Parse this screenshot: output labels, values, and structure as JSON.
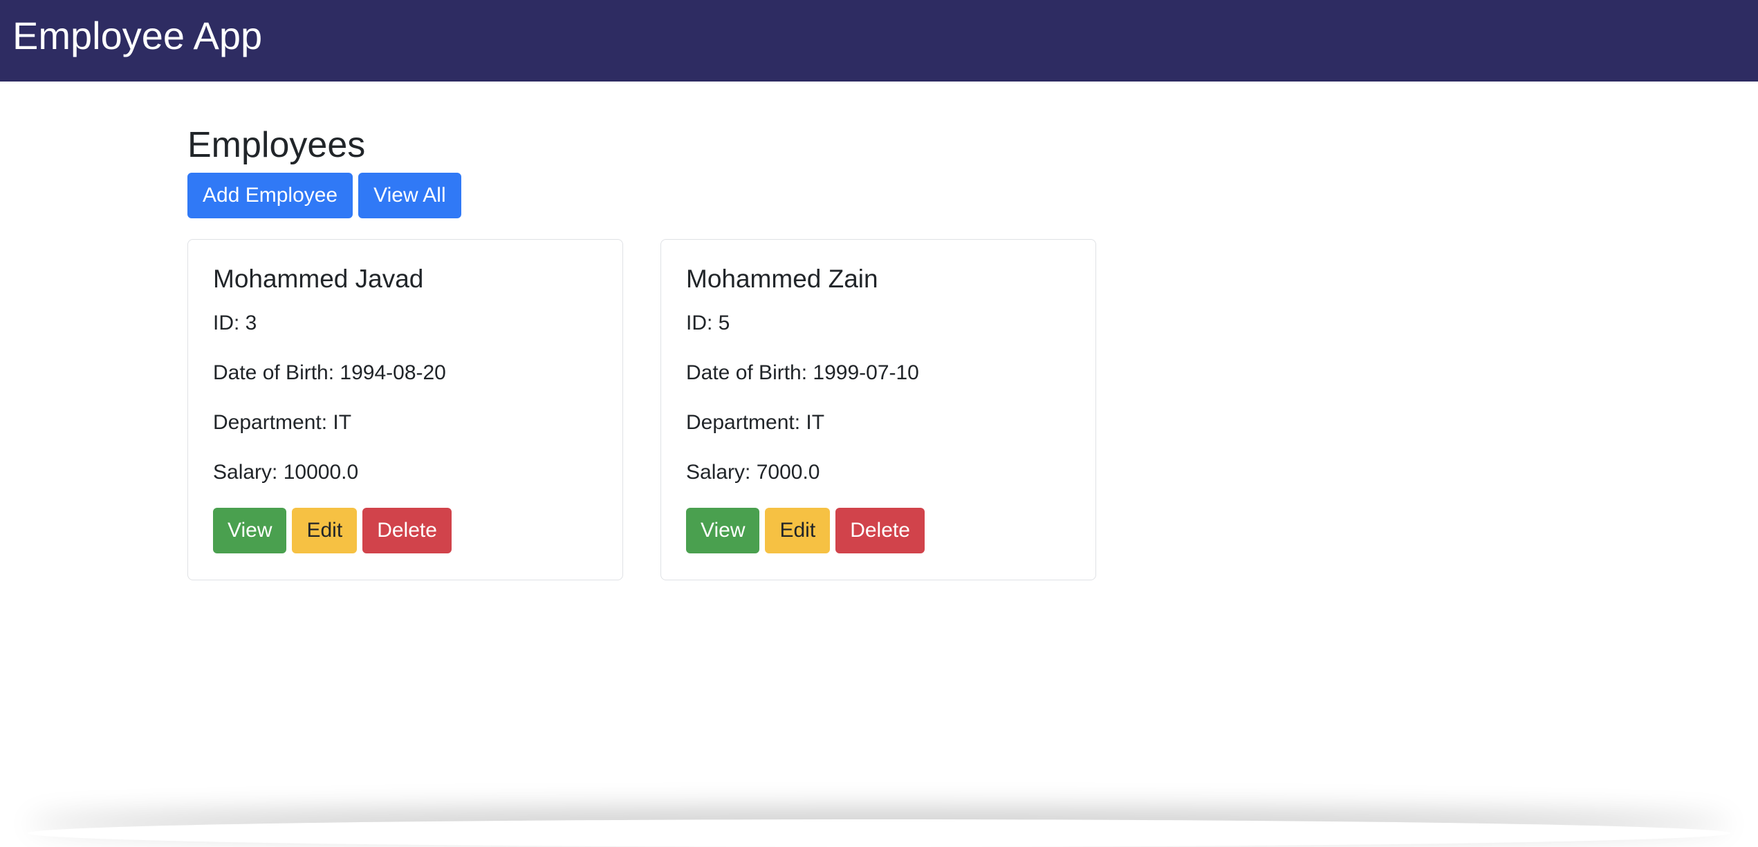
{
  "navbar": {
    "brand": "Employee App"
  },
  "page": {
    "title": "Employees",
    "actions": {
      "add_label": "Add Employee",
      "view_all_label": "View All"
    }
  },
  "employees": [
    {
      "name": "Mohammed Javad",
      "id_text": "ID: 3",
      "dob_text": "Date of Birth: 1994-08-20",
      "department_text": "Department: IT",
      "salary_text": "Salary: 10000.0",
      "view_label": "View",
      "edit_label": "Edit",
      "delete_label": "Delete"
    },
    {
      "name": "Mohammed Zain",
      "id_text": "ID: 5",
      "dob_text": "Date of Birth: 1999-07-10",
      "department_text": "Department: IT",
      "salary_text": "Salary: 7000.0",
      "view_label": "View",
      "edit_label": "Edit",
      "delete_label": "Delete"
    }
  ],
  "colors": {
    "navbar_bg": "#2e2c62",
    "primary": "#3079f6",
    "success": "#4aa04f",
    "warning": "#f6c143",
    "danger": "#d1434b"
  }
}
